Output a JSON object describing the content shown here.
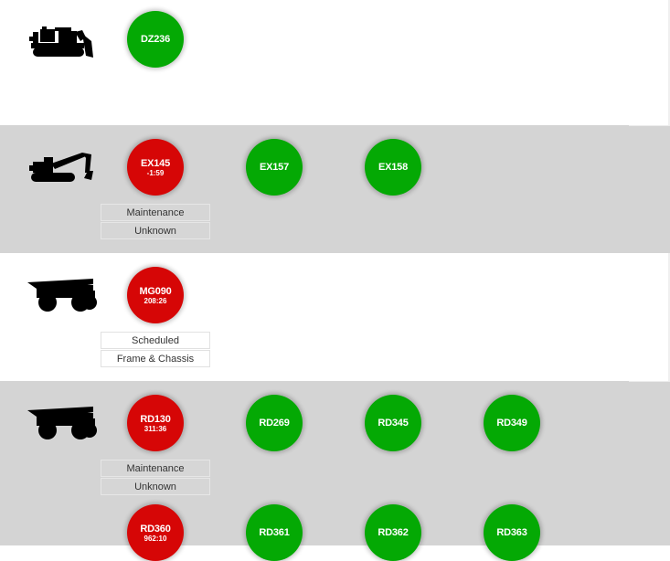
{
  "colors": {
    "available": "#04a904",
    "down": "#d60606",
    "band_grey": "#d4d4d4",
    "band_white": "#ffffff"
  },
  "groups": [
    {
      "equipment_icon": "dozer-icon",
      "units": [
        {
          "id": "DZ236",
          "status": "green",
          "time": ""
        }
      ],
      "details": []
    },
    {
      "equipment_icon": "excavator-icon",
      "units": [
        {
          "id": "EX145",
          "status": "red",
          "time": "-1:59"
        },
        {
          "id": "EX157",
          "status": "green",
          "time": ""
        },
        {
          "id": "EX158",
          "status": "green",
          "time": ""
        }
      ],
      "details": [
        "Maintenance",
        "Unknown"
      ]
    },
    {
      "equipment_icon": "haul-truck-icon",
      "units": [
        {
          "id": "MG090",
          "status": "red",
          "time": "208:26"
        }
      ],
      "details": [
        "Scheduled",
        "Frame & Chassis"
      ]
    },
    {
      "equipment_icon": "haul-truck-icon",
      "units": [
        {
          "id": "RD130",
          "status": "red",
          "time": "311:36"
        },
        {
          "id": "RD269",
          "status": "green",
          "time": ""
        },
        {
          "id": "RD345",
          "status": "green",
          "time": ""
        },
        {
          "id": "RD349",
          "status": "green",
          "time": ""
        },
        {
          "id": "RD360",
          "status": "red",
          "time": "962:10"
        },
        {
          "id": "RD361",
          "status": "green",
          "time": ""
        },
        {
          "id": "RD362",
          "status": "green",
          "time": ""
        },
        {
          "id": "RD363",
          "status": "green",
          "time": ""
        }
      ],
      "details": [
        "Maintenance",
        "Unknown"
      ]
    }
  ]
}
